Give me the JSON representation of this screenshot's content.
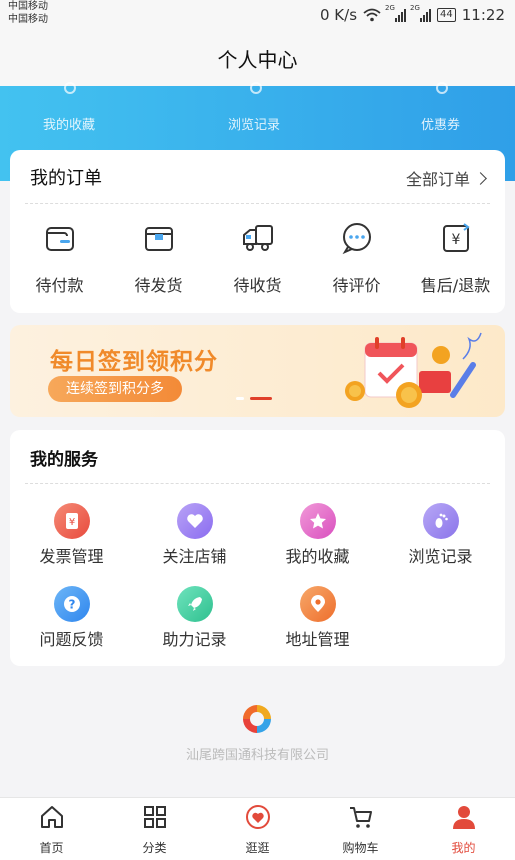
{
  "status_bar": {
    "carrier1": "中国移动",
    "carrier2": "中国移动",
    "speed": "0 K/s",
    "network1": "2G",
    "network2": "2G",
    "battery": "44",
    "time": "11:22"
  },
  "header": {
    "title": "个人中心"
  },
  "shortcuts": [
    {
      "label": "我的收藏"
    },
    {
      "label": "浏览记录"
    },
    {
      "label": "优惠券"
    }
  ],
  "orders": {
    "title": "我的订单",
    "all_label": "全部订单",
    "items": [
      {
        "label": "待付款",
        "icon": "wallet-icon"
      },
      {
        "label": "待发货",
        "icon": "package-icon"
      },
      {
        "label": "待收货",
        "icon": "truck-icon"
      },
      {
        "label": "待评价",
        "icon": "chat-icon"
      },
      {
        "label": "售后/退款",
        "icon": "refund-icon"
      }
    ]
  },
  "promo": {
    "title": "每日签到领积分",
    "subtitle": "连续签到积分多",
    "slide_count": 2,
    "active_slide": 2
  },
  "services": {
    "title": "我的服务",
    "items": [
      {
        "label": "发票管理",
        "icon": "invoice-icon",
        "color": "#ee5a4a"
      },
      {
        "label": "关注店铺",
        "icon": "heart-icon",
        "color": "#9b7cf0"
      },
      {
        "label": "我的收藏",
        "icon": "star-icon",
        "color": "#e768c8"
      },
      {
        "label": "浏览记录",
        "icon": "footprint-icon",
        "color": "#9a84ee"
      },
      {
        "label": "问题反馈",
        "icon": "question-icon",
        "color": "#3d8ff0"
      },
      {
        "label": "助力记录",
        "icon": "rocket-icon",
        "color": "#3fcfa2"
      },
      {
        "label": "地址管理",
        "icon": "location-pin-icon",
        "color": "#f2833a"
      }
    ]
  },
  "footer": {
    "company": "汕尾跨国通科技有限公司"
  },
  "tabbar": {
    "items": [
      {
        "label": "首页",
        "icon": "home-icon"
      },
      {
        "label": "分类",
        "icon": "grid-icon"
      },
      {
        "label": "逛逛",
        "icon": "heart-bubble-icon"
      },
      {
        "label": "购物车",
        "icon": "cart-icon"
      },
      {
        "label": "我的",
        "icon": "user-icon"
      }
    ],
    "active_index": 4,
    "accent": "#e24a3b"
  }
}
